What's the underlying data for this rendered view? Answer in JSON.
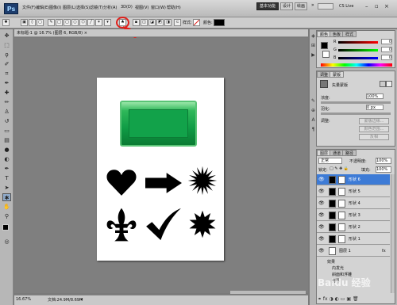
{
  "app": {
    "logo": "Ps",
    "menus": [
      "文件(F)",
      "编辑(E)",
      "图像(I)",
      "图层(L)",
      "选择(S)",
      "滤镜(T)",
      "分析(A)",
      "3D(D)",
      "视图(V)",
      "窗口(W)",
      "帮助(H)"
    ],
    "zoom": "33.7",
    "workspace_buttons": [
      "基本功能",
      "设计",
      "绘画"
    ],
    "cs_live": "CS Live",
    "window_controls": [
      "–",
      "▫",
      "×"
    ]
  },
  "options_bar": {
    "style_label": "样式:",
    "color_label": "颜色:"
  },
  "document": {
    "tab_title": "未标题-1 @ 16.7% (图层 6, RGB/8) ×",
    "status_zoom": "16.67%",
    "status_doc": "文档:24.9M/8.69M"
  },
  "panels": {
    "color_tabs": [
      "颜色",
      "色板",
      "样式"
    ],
    "color_values": [
      "R",
      "G",
      "B"
    ],
    "color_numbers": [
      "0",
      "0",
      "0"
    ],
    "adjust_tabs": [
      "调整",
      "蒙版"
    ],
    "mask_title": "矢量蒙版",
    "density_label": "浓度:",
    "density_value": "100%",
    "feather_label": "羽化:",
    "feather_value": "0 px",
    "refine_label": "调整:",
    "mask_buttons": [
      "蒙版边缘...",
      "颜色范围...",
      "反相"
    ],
    "layer_tabs": [
      "图层",
      "通道",
      "路径"
    ],
    "blend_mode": "正常",
    "opacity_label": "不透明度:",
    "opacity_value": "100%",
    "lock_label": "锁定:",
    "fill_label": "填充:",
    "fill_value": "100%",
    "layers": [
      {
        "name": "形状 6",
        "selected": true
      },
      {
        "name": "形状 5",
        "selected": false
      },
      {
        "name": "形状 4",
        "selected": false
      },
      {
        "name": "形状 3",
        "selected": false
      },
      {
        "name": "形状 2",
        "selected": false
      },
      {
        "name": "形状 1",
        "selected": false
      },
      {
        "name": "图层 1",
        "selected": false
      }
    ],
    "effects_label": "效果",
    "effect_items": [
      "内发光",
      "斜面和浮雕",
      "光泽"
    ],
    "fx": "fx"
  },
  "watermark": "Baidu 经验",
  "colors": {
    "accent_selected": "#3d7bd6",
    "annotation_red": "#e0201b",
    "button_green": "#12a24a"
  }
}
